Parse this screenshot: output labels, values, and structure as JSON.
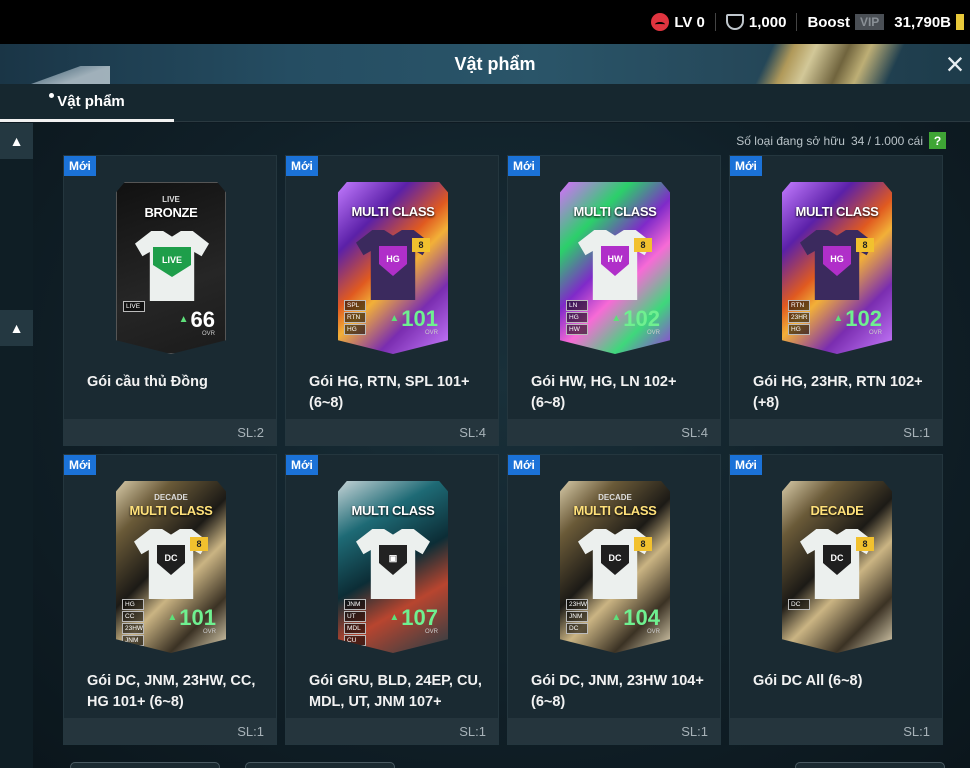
{
  "topbar": {
    "level": "LV 0",
    "coins": "1,000",
    "boost_label": "Boost",
    "vip_label": "VIP",
    "bp": "31,790B"
  },
  "header": {
    "title": "Vật phẩm"
  },
  "tabs": [
    {
      "label": "Vật phẩm",
      "active": true
    }
  ],
  "owned": {
    "label": "Số loại đang sở hữu",
    "value": "34 / 1.000 cái",
    "help": "?"
  },
  "items": [
    {
      "badge": "Mới",
      "name": "Gói cầu thủ Đồng",
      "qty": "SL:2",
      "style": "bronze",
      "sub": "LIVE",
      "title": "BRONZE",
      "crest": "LIVE",
      "level": "",
      "classes": [
        "LIVE"
      ],
      "ovr": "66",
      "ovr_label": "OVR"
    },
    {
      "badge": "Mới",
      "name": "Gói HG, RTN, SPL 101+ (6~8)",
      "qty": "SL:4",
      "style": "multi",
      "sub": "",
      "title": "MULTI CLASS",
      "crest": "HG",
      "level": "8",
      "classes": [
        "SPL",
        "RTN",
        "HG"
      ],
      "ovr": "101",
      "ovr_label": "OVR"
    },
    {
      "badge": "Mới",
      "name": "Gói HW, HG, LN 102+ (6~8)",
      "qty": "SL:4",
      "style": "multi2",
      "sub": "",
      "title": "MULTI CLASS",
      "crest": "HW",
      "level": "8",
      "classes": [
        "LN",
        "HG",
        "HW"
      ],
      "ovr": "102",
      "ovr_label": "OVR"
    },
    {
      "badge": "Mới",
      "name": "Gói HG, 23HR, RTN 102+ (+8)",
      "qty": "SL:1",
      "style": "multi",
      "sub": "",
      "title": "MULTI CLASS",
      "crest": "HG",
      "level": "8",
      "classes": [
        "RTN",
        "23HR",
        "HG"
      ],
      "ovr": "102",
      "ovr_label": "OVR"
    },
    {
      "badge": "Mới",
      "name": "Gói DC, JNM, 23HW, CC, HG 101+ (6~8)",
      "qty": "SL:1",
      "style": "decade",
      "sub": "DECADE",
      "title": "MULTI CLASS",
      "crest": "DC",
      "level": "8",
      "classes": [
        "HG",
        "CC",
        "23HW",
        "JNM",
        "DC"
      ],
      "ovr": "101",
      "ovr_label": "OVR"
    },
    {
      "badge": "Mới",
      "name": "Gói GRU, BLD, 24EP, CU, MDL, UT, JNM 107+",
      "qty": "SL:1",
      "style": "teal",
      "sub": "",
      "title": "MULTI CLASS",
      "crest": "▣",
      "level": "",
      "classes": [
        "JNM",
        "UT",
        "MDL",
        "CU",
        "24EP",
        "BLD",
        "GRU"
      ],
      "ovr": "107",
      "ovr_label": "OVR"
    },
    {
      "badge": "Mới",
      "name": "Gói DC, JNM, 23HW 104+ (6~8)",
      "qty": "SL:1",
      "style": "decade",
      "sub": "DECADE",
      "title": "MULTI CLASS",
      "crest": "DC",
      "level": "8",
      "classes": [
        "23HW",
        "JNM",
        "DC"
      ],
      "ovr": "104",
      "ovr_label": "OVR"
    },
    {
      "badge": "Mới",
      "name": "Gói DC All (6~8)",
      "qty": "SL:1",
      "style": "decade",
      "sub": "",
      "title": "DECADE",
      "crest": "DC",
      "level": "8",
      "classes": [
        "DC"
      ],
      "ovr": "",
      "ovr_label": ""
    }
  ],
  "colors": {
    "badge_new": "#1b72d8",
    "ovr_green": "#6ff090",
    "help_green": "#3fa535",
    "level_gold": "#f2c12e"
  }
}
